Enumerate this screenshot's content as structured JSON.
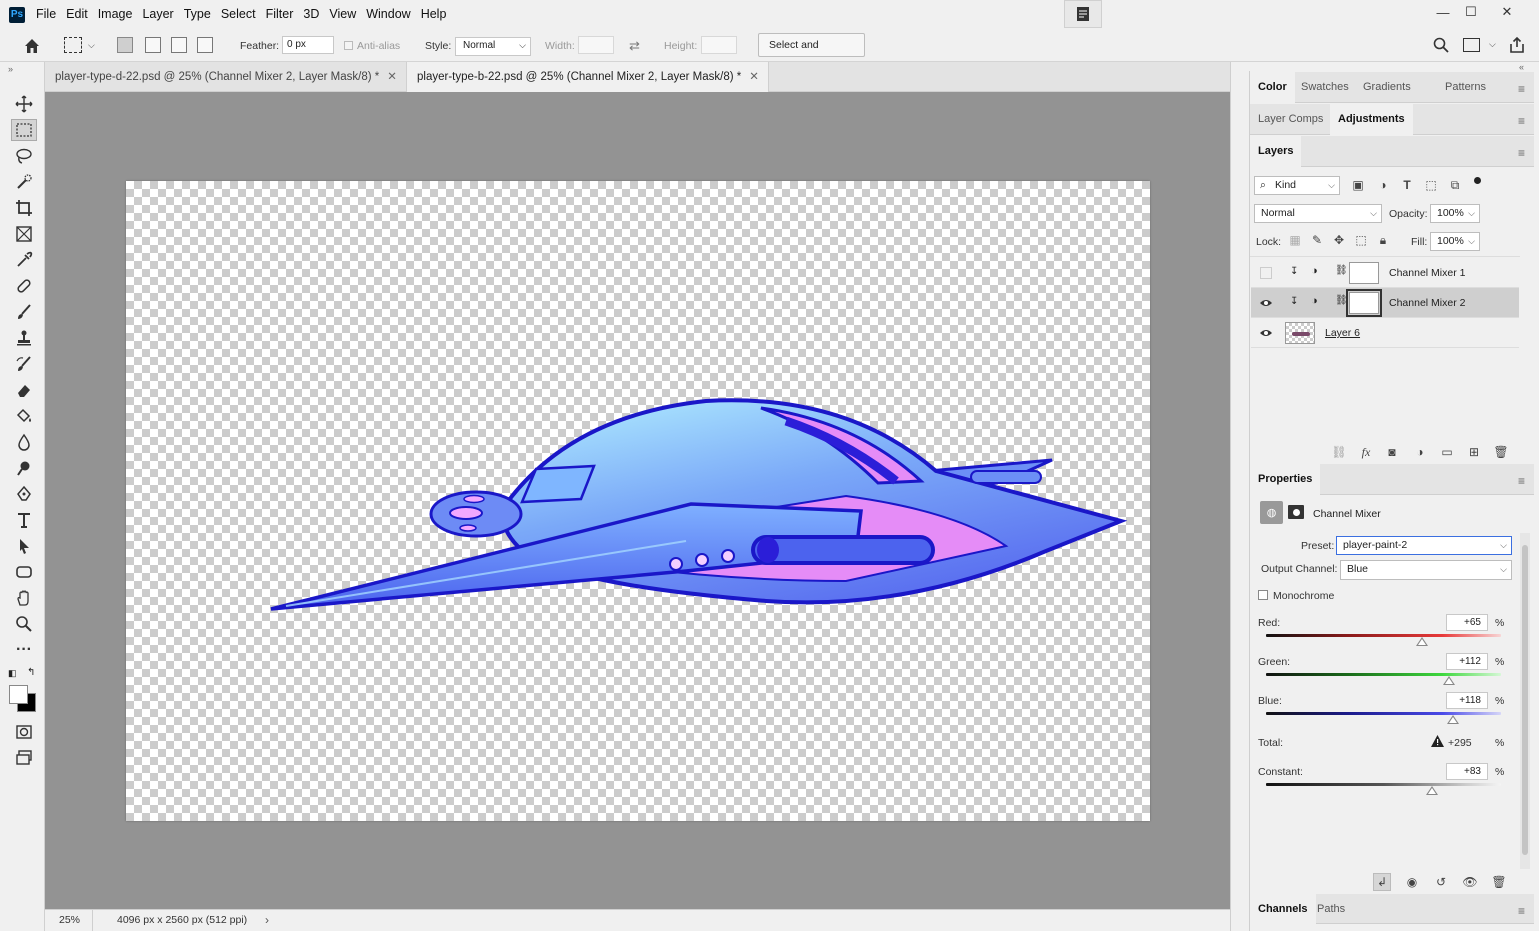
{
  "app": {
    "logo": "Ps"
  },
  "menu": [
    "File",
    "Edit",
    "Image",
    "Layer",
    "Type",
    "Select",
    "Filter",
    "3D",
    "View",
    "Window",
    "Help"
  ],
  "window_controls": {
    "minimize": "—",
    "maximize": "☐",
    "close": "✕"
  },
  "options_bar": {
    "feather_label": "Feather:",
    "feather_value": "0 px",
    "antialias_label": "Anti-alias",
    "style_label": "Style:",
    "style_value": "Normal",
    "width_label": "Width:",
    "height_label": "Height:",
    "select_mask_button": "Select and Mask..."
  },
  "tabs": [
    {
      "label": "player-type-d-22.psd @ 25% (Channel Mixer 2, Layer Mask/8) *",
      "active": false
    },
    {
      "label": "player-type-b-22.psd @ 25% (Channel Mixer 2, Layer Mask/8) *",
      "active": true
    }
  ],
  "status": {
    "zoom": "25%",
    "doc_info": "4096 px x 2560 px (512 ppi)"
  },
  "panels": {
    "top_tabs": [
      "Color",
      "Swatches",
      "Gradients",
      "Patterns"
    ],
    "mid_tabs": [
      "Layer Comps",
      "Adjustments"
    ],
    "layers_tab": "Layers",
    "filter_kind": "Kind",
    "blend_mode": "Normal",
    "opacity_label": "Opacity:",
    "opacity_value": "100%",
    "lock_label": "Lock:",
    "fill_label": "Fill:",
    "fill_value": "100%",
    "layers": [
      {
        "name": "Channel Mixer 1",
        "visible": false,
        "selected": false
      },
      {
        "name": "Channel Mixer 2",
        "visible": true,
        "selected": true
      },
      {
        "name": "Layer 6",
        "visible": true,
        "selected": false
      }
    ],
    "properties_tab": "Properties",
    "properties_title": "Channel Mixer",
    "preset_label": "Preset:",
    "preset_value": "player-paint-2",
    "output_label": "Output Channel:",
    "output_value": "Blue",
    "monochrome_label": "Monochrome",
    "red_label": "Red:",
    "red_value": "+65",
    "red_level": 65,
    "green_label": "Green:",
    "green_value": "+112",
    "green_level": 112,
    "blue_label": "Blue:",
    "blue_value": "+118",
    "blue_level": 118,
    "total_label": "Total:",
    "total_value": "+295",
    "constant_label": "Constant:",
    "constant_value": "+83",
    "constant_level": 83,
    "percent": "%",
    "bottom_tabs": [
      "Channels",
      "Paths"
    ]
  },
  "colors": {
    "ship_main": "#5f7ef5",
    "ship_outline": "#1a17c8",
    "ship_accent": "#e58cf7",
    "ship_highlight": "#a8e4ff"
  }
}
